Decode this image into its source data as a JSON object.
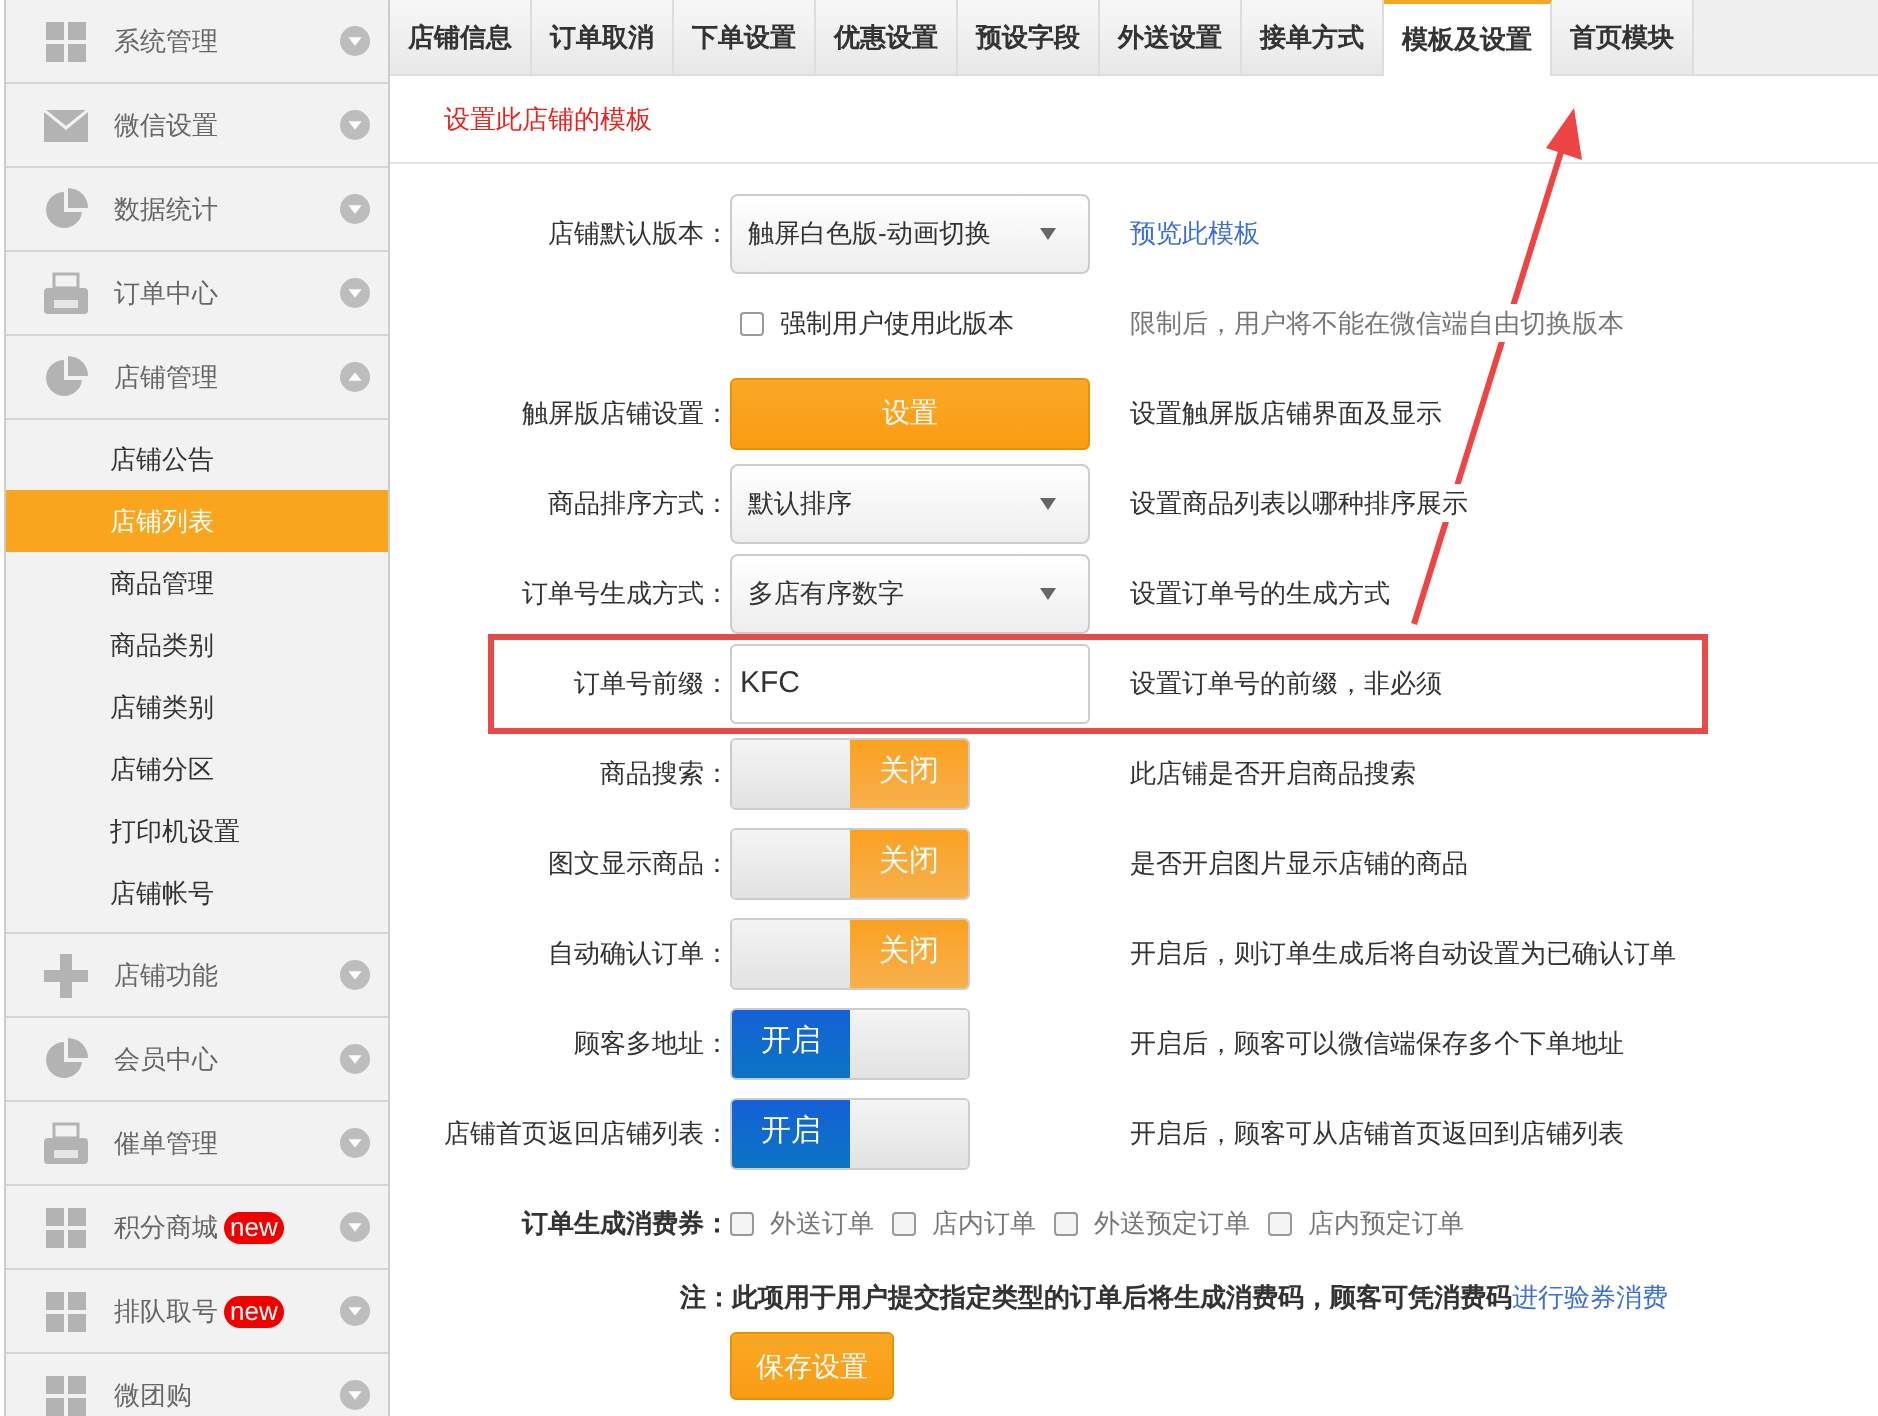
{
  "sidebar": {
    "items": [
      {
        "label": "系统管理",
        "expanded": false
      },
      {
        "label": "微信设置",
        "expanded": false
      },
      {
        "label": "数据统计",
        "expanded": false
      },
      {
        "label": "订单中心",
        "expanded": false
      },
      {
        "label": "店铺管理",
        "expanded": true,
        "children": [
          {
            "label": "店铺公告",
            "selected": false
          },
          {
            "label": "店铺列表",
            "selected": true
          },
          {
            "label": "商品管理",
            "selected": false
          },
          {
            "label": "商品类别",
            "selected": false
          },
          {
            "label": "店铺类别",
            "selected": false
          },
          {
            "label": "店铺分区",
            "selected": false
          },
          {
            "label": "打印机设置",
            "selected": false
          },
          {
            "label": "店铺帐号",
            "selected": false
          }
        ]
      },
      {
        "label": "店铺功能",
        "expanded": false
      },
      {
        "label": "会员中心",
        "expanded": false
      },
      {
        "label": "催单管理",
        "expanded": false
      },
      {
        "label": "积分商城",
        "expanded": false,
        "badge": "new"
      },
      {
        "label": "排队取号",
        "expanded": false,
        "badge": "new"
      },
      {
        "label": "微团购",
        "expanded": false
      }
    ]
  },
  "tabs": [
    {
      "label": "店铺信息",
      "selected": false
    },
    {
      "label": "订单取消",
      "selected": false
    },
    {
      "label": "下单设置",
      "selected": false
    },
    {
      "label": "优惠设置",
      "selected": false
    },
    {
      "label": "预设字段",
      "selected": false
    },
    {
      "label": "外送设置",
      "selected": false
    },
    {
      "label": "接单方式",
      "selected": false
    },
    {
      "label": "模板及设置",
      "selected": true
    },
    {
      "label": "首页模块",
      "selected": false
    }
  ],
  "section_title": "设置此店铺的模板",
  "form": {
    "rows": [
      {
        "kind": "select",
        "label": "店铺默认版本：",
        "value": "触屏白色版-动画切换",
        "link": "预览此模板"
      },
      {
        "kind": "checkbox",
        "text": "强制用户使用此版本",
        "checked": false,
        "hint": "限制后，用户将不能在微信端自由切换版本"
      },
      {
        "kind": "button",
        "label": "触屏版店铺设置：",
        "text": "设置",
        "hint": "设置触屏版店铺界面及显示"
      },
      {
        "kind": "select",
        "label": "商品排序方式：",
        "value": "默认排序",
        "hint": "设置商品列表以哪种排序展示"
      },
      {
        "kind": "select",
        "label": "订单号生成方式：",
        "value": "多店有序数字",
        "hint": "设置订单号的生成方式"
      },
      {
        "kind": "input",
        "label": "订单号前缀：",
        "value": "KFC",
        "hint": "设置订单号的前缀，非必须",
        "highlighted": true
      },
      {
        "kind": "toggle",
        "label": "商品搜索：",
        "on": false,
        "text": "关闭",
        "hint": "此店铺是否开启商品搜索"
      },
      {
        "kind": "toggle",
        "label": "图文显示商品：",
        "on": false,
        "text": "关闭",
        "hint": "是否开启图片显示店铺的商品"
      },
      {
        "kind": "toggle",
        "label": "自动确认订单：",
        "on": false,
        "text": "关闭",
        "hint": "开启后，则订单生成后将自动设置为已确认订单"
      },
      {
        "kind": "toggle",
        "label": "顾客多地址：",
        "on": true,
        "text": "开启",
        "hint": "开启后，顾客可以微信端保存多个下单地址"
      },
      {
        "kind": "toggle",
        "label": "店铺首页返回店铺列表：",
        "on": true,
        "text": "开启",
        "hint": "开启后，顾客可从店铺首页返回到店铺列表"
      }
    ]
  },
  "voucher": {
    "label": "订单生成消费券：",
    "options": [
      {
        "text": "外送订单",
        "checked": false
      },
      {
        "text": "店内订单",
        "checked": false
      },
      {
        "text": "外送预定订单",
        "checked": false
      },
      {
        "text": "店内预定订单",
        "checked": false
      }
    ]
  },
  "note": {
    "text": "注：此项用于用户提交指定类型的订单后将生成消费码，顾客可凭消费码",
    "link": "进行验券消费"
  },
  "save_button": "保存设置"
}
